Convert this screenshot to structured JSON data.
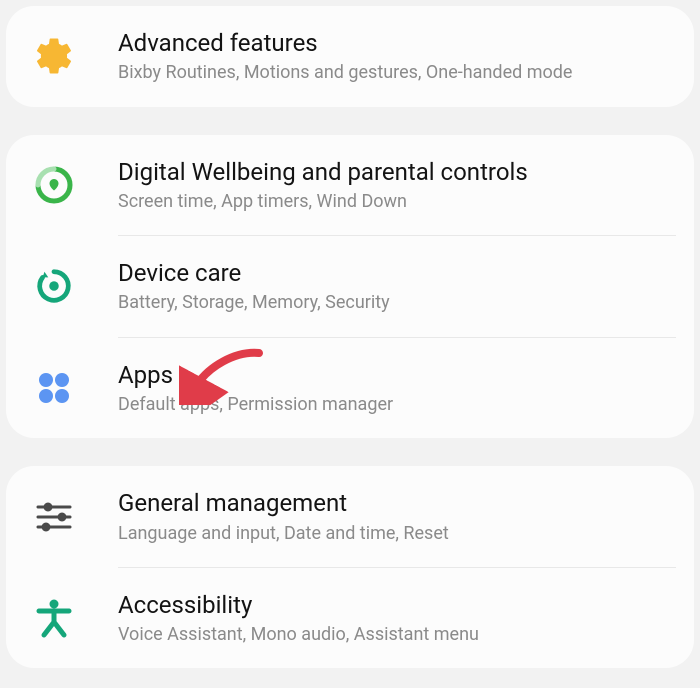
{
  "groups": [
    {
      "items": [
        {
          "key": "advanced-features",
          "title": "Advanced features",
          "subtitle": "Bixby Routines, Motions and gestures, One-handed mode"
        }
      ]
    },
    {
      "items": [
        {
          "key": "digital-wellbeing",
          "title": "Digital Wellbeing and parental controls",
          "subtitle": "Screen time, App timers, Wind Down"
        },
        {
          "key": "device-care",
          "title": "Device care",
          "subtitle": "Battery, Storage, Memory, Security"
        },
        {
          "key": "apps",
          "title": "Apps",
          "subtitle": "Default apps, Permission manager"
        }
      ]
    },
    {
      "items": [
        {
          "key": "general-management",
          "title": "General management",
          "subtitle": "Language and input, Date and time, Reset"
        },
        {
          "key": "accessibility",
          "title": "Accessibility",
          "subtitle": "Voice Assistant, Mono audio, Assistant menu"
        }
      ]
    }
  ],
  "colors": {
    "gear": "#f7b733",
    "wellbeing": "#3ab54a",
    "devicecare": "#15a67a",
    "apps": "#4f8ef7",
    "sliders": "#4a4a4a",
    "accessibility": "#15a67a",
    "arrow": "#e03c49"
  }
}
